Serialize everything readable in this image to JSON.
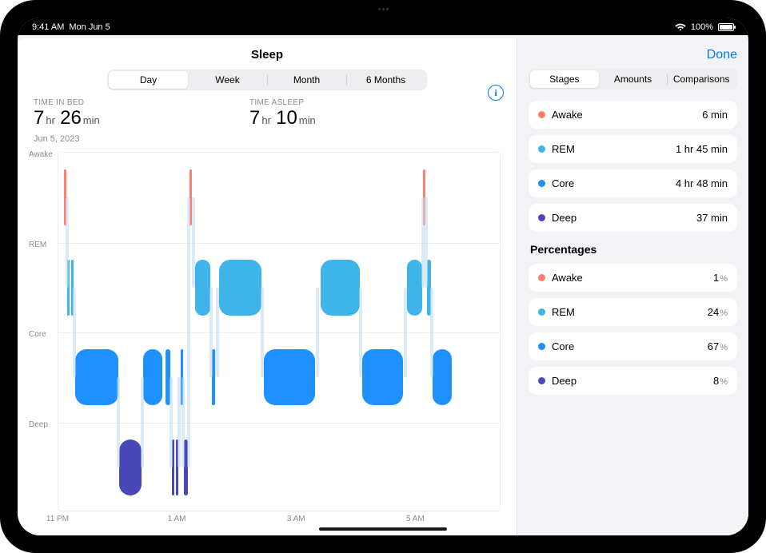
{
  "status_bar": {
    "time": "9:41 AM",
    "date": "Mon Jun 5",
    "battery_pct": "100%"
  },
  "page": {
    "title": "Sleep",
    "done": "Done"
  },
  "main_segments": [
    "Day",
    "Week",
    "Month",
    "6 Months"
  ],
  "main_segment_active": 0,
  "side_segments": [
    "Stages",
    "Amounts",
    "Comparisons"
  ],
  "side_segment_active": 0,
  "summary": {
    "in_bed_label": "TIME IN BED",
    "in_bed_hr": "7",
    "in_bed_hr_u": "hr",
    "in_bed_min": "26",
    "in_bed_min_u": "min",
    "asleep_label": "TIME ASLEEP",
    "asleep_hr": "7",
    "asleep_hr_u": "hr",
    "asleep_min": "10",
    "asleep_min_u": "min",
    "date": "Jun 5, 2023"
  },
  "colors": {
    "awake": "#ff7f6b",
    "rem": "#3fb4e8",
    "core": "#1e90ff",
    "deep": "#4848b8"
  },
  "chart_data": {
    "type": "sleep-stage-timeline",
    "title": "Sleep",
    "x_unit": "time (hours)",
    "x_range_hours": [
      23,
      30.43
    ],
    "x_ticks": [
      "11 PM",
      "1 AM",
      "3 AM",
      "5 AM"
    ],
    "lanes": [
      "Awake",
      "REM",
      "Core",
      "Deep"
    ],
    "lane_colors": {
      "Awake": "#ff7f6b",
      "REM": "#3fb4e8",
      "Core": "#1e90ff",
      "Deep": "#4848b8"
    },
    "segments": [
      {
        "stage": "Awake",
        "start": 23.1,
        "end": 23.14
      },
      {
        "stage": "REM",
        "start": 23.15,
        "end": 23.19
      },
      {
        "stage": "REM",
        "start": 23.22,
        "end": 23.26
      },
      {
        "stage": "Core",
        "start": 23.28,
        "end": 24.0
      },
      {
        "stage": "Deep",
        "start": 24.02,
        "end": 24.4
      },
      {
        "stage": "Core",
        "start": 24.42,
        "end": 24.75
      },
      {
        "stage": "Core",
        "start": 24.8,
        "end": 24.88
      },
      {
        "stage": "Deep",
        "start": 24.9,
        "end": 24.94
      },
      {
        "stage": "Deep",
        "start": 24.97,
        "end": 25.01
      },
      {
        "stage": "Core",
        "start": 25.05,
        "end": 25.08
      },
      {
        "stage": "Deep",
        "start": 25.1,
        "end": 25.17
      },
      {
        "stage": "Awake",
        "start": 25.2,
        "end": 25.24
      },
      {
        "stage": "REM",
        "start": 25.3,
        "end": 25.55
      },
      {
        "stage": "Core",
        "start": 25.58,
        "end": 25.63
      },
      {
        "stage": "REM",
        "start": 25.7,
        "end": 26.4
      },
      {
        "stage": "Core",
        "start": 26.45,
        "end": 27.3
      },
      {
        "stage": "REM",
        "start": 27.4,
        "end": 28.05
      },
      {
        "stage": "Core",
        "start": 28.1,
        "end": 28.78
      },
      {
        "stage": "REM",
        "start": 28.85,
        "end": 29.1
      },
      {
        "stage": "Awake",
        "start": 29.12,
        "end": 29.16
      },
      {
        "stage": "REM",
        "start": 29.18,
        "end": 29.25
      },
      {
        "stage": "Core",
        "start": 29.28,
        "end": 29.6
      }
    ],
    "totals": {
      "Awake": "6 min",
      "REM": "1 hr 45 min",
      "Core": "4 hr 48 min",
      "Deep": "37 min"
    },
    "percent": {
      "Awake": 1,
      "REM": 24,
      "Core": 67,
      "Deep": 8
    }
  },
  "stages_list": [
    {
      "key": "awake",
      "name": "Awake",
      "value": "6 min"
    },
    {
      "key": "rem",
      "name": "REM",
      "value": "1 hr 45 min"
    },
    {
      "key": "core",
      "name": "Core",
      "value": "4 hr 48 min"
    },
    {
      "key": "deep",
      "name": "Deep",
      "value": "37 min"
    }
  ],
  "percent_header": "Percentages",
  "percent_list": [
    {
      "key": "awake",
      "name": "Awake",
      "value": "1"
    },
    {
      "key": "rem",
      "name": "REM",
      "value": "24"
    },
    {
      "key": "core",
      "name": "Core",
      "value": "67"
    },
    {
      "key": "deep",
      "name": "Deep",
      "value": "8"
    }
  ],
  "percent_unit": "%"
}
